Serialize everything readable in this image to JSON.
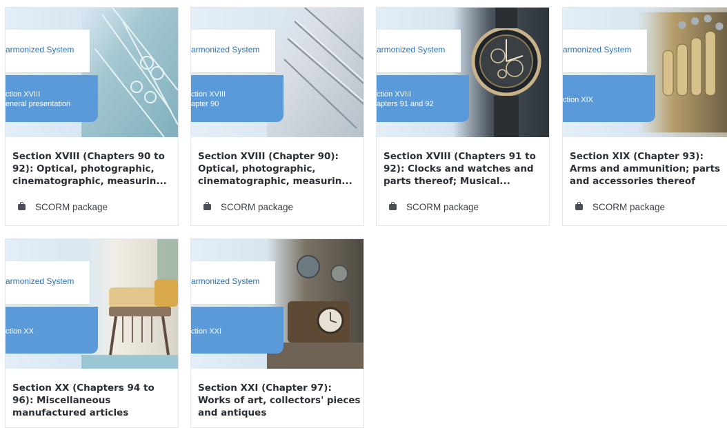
{
  "cards": [
    {
      "thumb": {
        "header": "armonized System",
        "line1": "ction XVIII",
        "line2": "eneral presentation"
      },
      "title": "Section XVIII (Chapters 90 to 92): Optical, photographic, cinematographic, measurin...",
      "activity_type": "SCORM package",
      "photo_icon": "surgical-instruments-photo"
    },
    {
      "thumb": {
        "header": "armonized System",
        "line1": "ction XVIII",
        "line2": "apter 90"
      },
      "title": "Section XVIII (Chapter 90): Optical, photographic, cinematographic, measurin...",
      "activity_type": "SCORM package",
      "photo_icon": "medical-tools-tray-photo"
    },
    {
      "thumb": {
        "header": "armonized System",
        "line1": "ction XVIII",
        "line2": "apters 91 and 92"
      },
      "title": "Section XVIII (Chapters 91 to 92): Clocks and watches and parts thereof; Musical...",
      "activity_type": "SCORM package",
      "photo_icon": "wristwatch-photo"
    },
    {
      "thumb": {
        "header": "armonized System",
        "line1": "ction XIX",
        "line2": ""
      },
      "title": "Section XIX (Chapter 93): Arms and ammunition; parts and accessories thereof",
      "activity_type": "SCORM package",
      "photo_icon": "ammunition-photo"
    },
    {
      "thumb": {
        "header": "armonized System",
        "line1": "ction XX",
        "line2": ""
      },
      "title": "Section XX (Chapters 94 to 96): Miscellaneous manufactured articles",
      "activity_type": "",
      "photo_icon": "armchair-photo"
    },
    {
      "thumb": {
        "header": "armonized System",
        "line1": "ction XXI",
        "line2": ""
      },
      "title": "Section XXI (Chapter 97): Works of art, collectors' pieces and antiques",
      "activity_type": "",
      "photo_icon": "antique-clock-photo"
    }
  ],
  "colors": {
    "brand_blue": "#5b9ad8",
    "header_text": "#2c6fb7",
    "title_text": "#2a2f35"
  }
}
